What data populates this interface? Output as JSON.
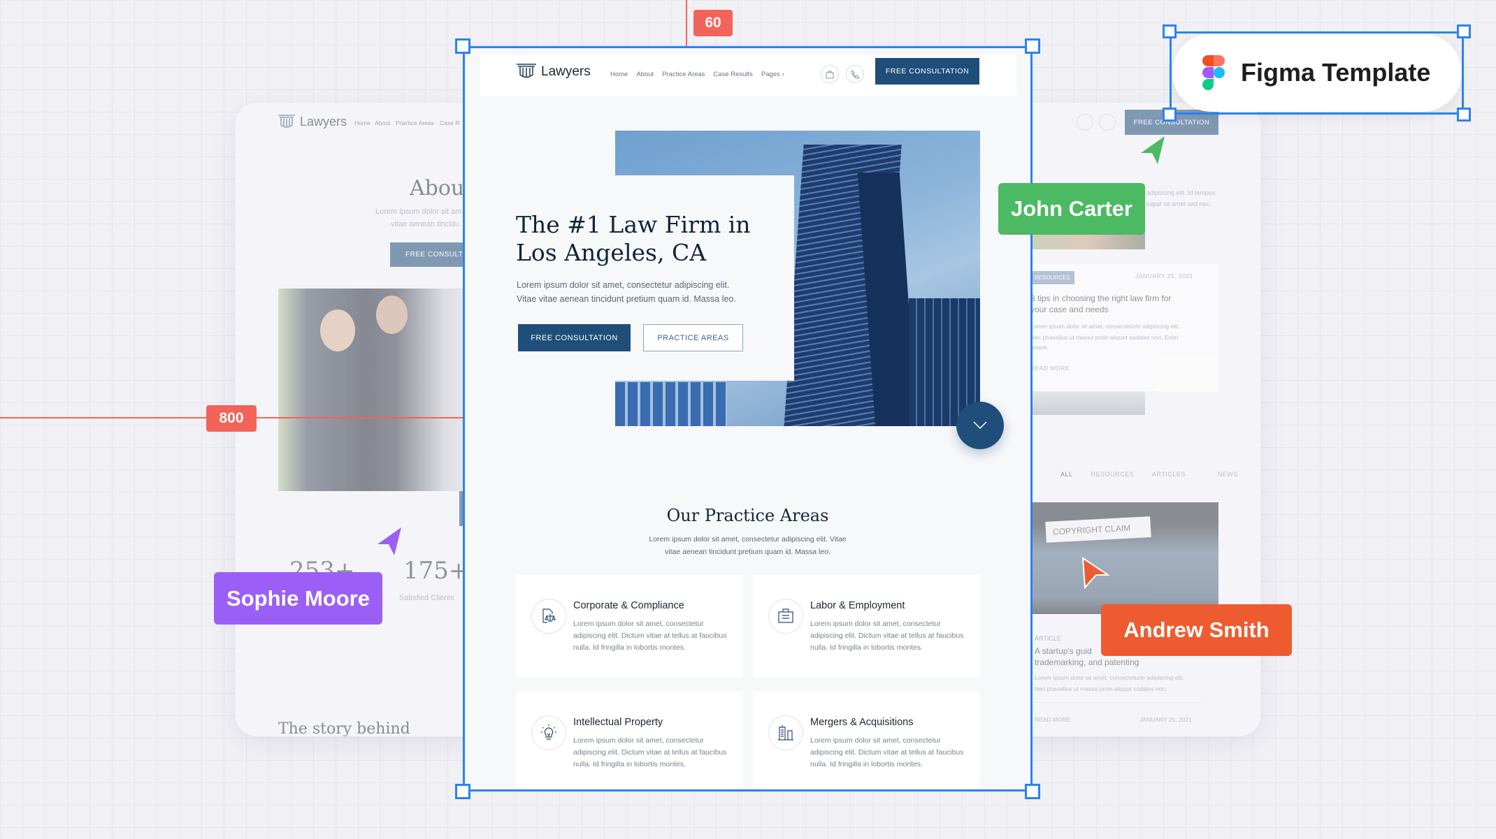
{
  "brand": {
    "name": "Lawyers"
  },
  "nav": {
    "items": [
      "Home",
      "About",
      "Practice Areas",
      "Case Results",
      "Pages ›"
    ],
    "cta": "FREE CONSULTATION"
  },
  "hero": {
    "title_line1": "The #1 Law Firm in",
    "title_line2": "Los Angeles, CA",
    "text_line1": "Lorem ipsum dolor sit amet, consectetur adipiscing elit.",
    "text_line2": "Vitae vitae aenean tincidunt pretium quam id. Massa leo.",
    "primary_button": "FREE CONSULTATION",
    "secondary_button": "PRACTICE AREAS"
  },
  "practice": {
    "title": "Our Practice Areas",
    "text_line1": "Lorem ipsum dolor sit amet, consectetur adipiscing elit. Vitae",
    "text_line2": "vitae aenean tincidunt pretium quam id. Massa leo.",
    "cards": [
      {
        "title": "Corporate & Compliance",
        "text": "Lorem ipsum dolor sit amet, consectetur adipiscing elit. Dictum vitae at tellus at faucibus nulla. Id fringilla in lobortis montes.",
        "icon": "document-scales-icon"
      },
      {
        "title": "Labor & Employment",
        "text": "Lorem ipsum dolor sit amet, consectetur adipiscing elit. Dictum vitae at tellus at faucibus nulla. Id fringilla in lobortis montes.",
        "icon": "briefcase-icon"
      },
      {
        "title": "Intellectual Property",
        "text": "Lorem ipsum dolor sit amet, consectetur adipiscing elit. Dictum vitae at tellus at faucibus nulla. Id fringilla in lobortis montes.",
        "icon": "lightbulb-icon"
      },
      {
        "title": "Mergers & Acquisitions",
        "text": "Lorem ipsum dolor sit amet, consectetur adipiscing elit. Dictum vitae at tellus at faucibus nulla. Id fringilla in lobortis montes.",
        "icon": "buildings-icon"
      }
    ]
  },
  "left_page": {
    "nav": [
      "Home",
      "About",
      "Practice Areas",
      "Case R"
    ],
    "title": "About",
    "text_line1": "Lorem ipsum dolor sit am",
    "text_line2": "vitae aenean tincidu",
    "button": "FREE CONSULTAT",
    "stat1": "253+",
    "stat2": "175+",
    "stat2_label": "Satisfied Clients",
    "story": "The story behind"
  },
  "right_page": {
    "button": "FREE CONSULTATION",
    "text_line1": "adipiscing elit. Id tempus",
    "text_line2": "lutpat sit amet sed nec.",
    "post1": {
      "badge": "RESOURCES",
      "date": "JANUARY 25, 2021",
      "title_line1": "3 tips in choosing the right law firm for",
      "title_line2": "your case and needs",
      "text_line1": "Lorem ipsum dolor sit amet, consecteturlo adipiscing elit.",
      "text_line2": "Nec phasellus ut massa proin aliquet sodales non. Enim",
      "text_line3": "neque.",
      "read_more": "READ MORE"
    },
    "tabs": [
      "ALL",
      "RESOURCES",
      "ARTICLES",
      "NEWS"
    ],
    "post2": {
      "image_text": "COPYRIGHT CLAIM",
      "category": "ARTICLE",
      "title_line1": "A startup's guid",
      "title_line2": "trademarking, and patenting",
      "text_line1": "Lorem ipsum dolor sit amet, consecteturlo adipiscing elit.",
      "text_line2": "Nec phasellus ut massa proin aliquet sodales non.",
      "read_more": "READ MORE",
      "date": "JANUARY 25, 2021"
    }
  },
  "guides": {
    "top": "60",
    "left": "800"
  },
  "badge": {
    "label": "Figma Template"
  },
  "collaborators": [
    {
      "name": "John Carter",
      "color": "#4cb963"
    },
    {
      "name": "Sophie Moore",
      "color": "#9b5ff5"
    },
    {
      "name": "Andrew Smith",
      "color": "#ef5b30"
    }
  ],
  "colors": {
    "primary": "#1f4e7a",
    "selection": "#2b83ee",
    "guide": "#f2645a"
  }
}
